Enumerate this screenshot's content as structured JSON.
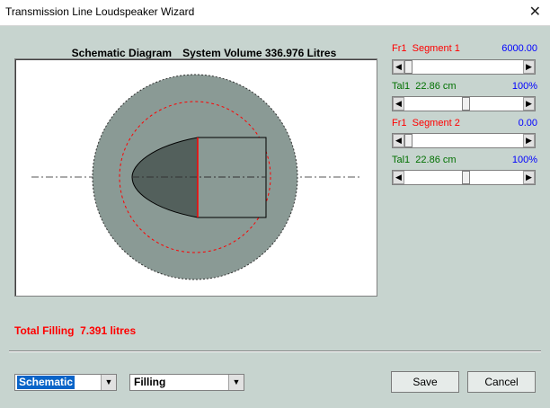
{
  "window": {
    "title": "Transmission Line Loudspeaker Wizard",
    "close_glyph": "✕"
  },
  "diagram": {
    "heading": "Schematic Diagram",
    "volume_text": "System Volume 336.976 Litres"
  },
  "segments": [
    {
      "label": "Fr1  Segment 1",
      "value": "6000.00",
      "label_color": "#ff0000",
      "value_color": "#0000ff",
      "slider_level": 0.0
    },
    {
      "label": "Tal1  22.86 cm",
      "value": "100%",
      "label_color": "#007000",
      "value_color": "#0000ff",
      "slider_level": 0.52
    },
    {
      "label": "Fr1  Segment 2",
      "value": "0.00",
      "label_color": "#ff0000",
      "value_color": "#0000ff",
      "slider_level": 0.0
    },
    {
      "label": "Tal1  22.86 cm",
      "value": "100%",
      "label_color": "#007000",
      "value_color": "#0000ff",
      "slider_level": 0.52
    }
  ],
  "total_filling": "Total Filling  7.391 litres",
  "view_select": {
    "value": "Schematic",
    "options": [
      "Schematic"
    ]
  },
  "mode_select": {
    "value": "Filling",
    "options": [
      "Filling"
    ]
  },
  "buttons": {
    "save": "Save",
    "cancel": "Cancel"
  }
}
